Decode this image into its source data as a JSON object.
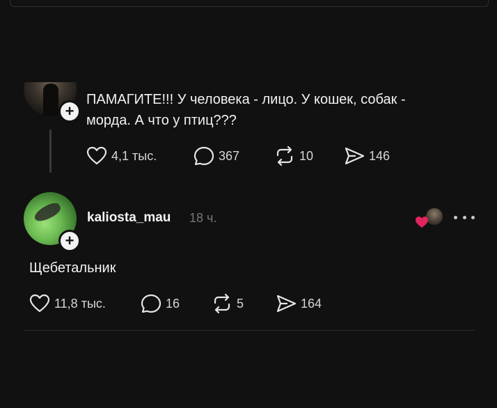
{
  "post1": {
    "text": "ПАМАГИТЕ!!! У человека - лицо. У кошек, собак -\nморда. А что у птиц???",
    "likes": "4,1 тыс.",
    "comments": "367",
    "reposts": "10",
    "shares": "146"
  },
  "post2": {
    "username": "kaliosta_mau",
    "time": "18 ч.",
    "text": "Щебетальник",
    "likes": "11,8 тыс.",
    "comments": "16",
    "reposts": "5",
    "shares": "164"
  },
  "icons": {
    "follow": "plus-icon",
    "like": "heart-icon",
    "comment": "comment-bubble-icon",
    "repost": "repost-icon",
    "share": "send-icon",
    "more": "more-icon"
  },
  "colors": {
    "background": "#111111",
    "text": "#f2f2f2",
    "muted": "#777777",
    "like_badge": "#e0245e"
  }
}
